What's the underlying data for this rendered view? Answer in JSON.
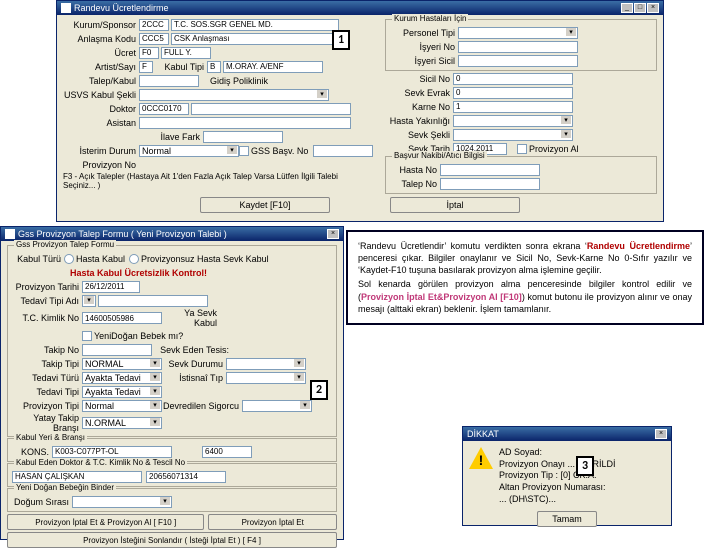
{
  "win1": {
    "title": "Randevu Ücretlendirme",
    "kurumSponsorL": "Kurum/Sponsor",
    "kurumSponsorCode": "2CCC",
    "kurumSponsorText": "T.C. SOS.SGR GENEL MD.",
    "anlasmaKoduL": "Anlaşma Kodu",
    "anlasmaKoduCode": "CCC5",
    "anlasmaKoduText": "CSK Anlaşması",
    "ucretL": "Ücret",
    "ucretCode": "F0",
    "ucretText": "FULL Y.",
    "artistSayiL": "Artist/Sayı",
    "artistSayi": "F",
    "kabulTipiL": "Kabul Tipi",
    "kabulTipiCode": "B",
    "kabulTipiText": "M.ORAY. A/ENF",
    "talepKabulL": "Talep/Kabul",
    "usvsKabulL": "USVS Kabul Şekli",
    "usvsKabul": "",
    "doktorL": "Doktor",
    "doktor": "0CCC0170",
    "asistanL": "Asistan",
    "ilaveFarkL": "İlave Fark",
    "isterimDurumL": "İsterim Durum",
    "isterimDurum": "Normal",
    "provNoL": "Provizyon No",
    "f3L": "F3 - Açık Talepler (Hastaya Ait 1'den Fazla Açık Talep Varsa Lütfen İlgili Talebi Seçiniz... )",
    "gssBasvNoL": "GSS Başv. No",
    "gidisPolL": "Gidiş Poliklinik",
    "kaydetBtn": "Kaydet [F10]",
    "iptalBtn": "İptal",
    "grpKurum": "Kurum Hastaları İçin",
    "personelTipiL": "Personel Tipi",
    "isyeriNoL": "İşyeri No",
    "isyeriSicilL": "İşyeri Sicil",
    "sicilNoL": "Sicil No",
    "sicilNo": "0",
    "sevkEvrakL": "Sevk Evrak",
    "sevkEvrak": "0",
    "karneNoL": "Karne No",
    "karneNo": "1",
    "hastaYakinL": "Hasta Yakınlığı",
    "sevkSekliL": "Sevk Şekli",
    "sevkTarihL": "Sevk Tarih",
    "sevkTarih": "1024.2011",
    "provizyonAlL": "Provizyon Al",
    "grpHasta": "Başvur Nakibi/Atıcı Bilgisi",
    "hastaNoL": "Hasta No",
    "talepNoL": "Talep No"
  },
  "win2": {
    "title": "Gss Provizyon Talep Formu ( Yeni Provizyon Talebi )",
    "grpTop": "Gss Provizyon Talep Formu",
    "kabulTuruL": "Kabul Türü",
    "opt1": "Hasta Kabul",
    "opt2": "Provizyonsuz Hasta Sevk Kabul",
    "warn": "Hasta Kabul Ücretsizlik Kontrol!",
    "provTarihiL": "Provizyon Tarihi",
    "provTarihi": "26/12/2011",
    "tedaviTipiL": "Tedavî Tipi Adı",
    "tedaviTipiCode": "•",
    "tcKimlikL": "T.C. Kimlik No",
    "tcKimlik": "14600505986",
    "yaSevkKabulL": "Ya Sevk Kabul",
    "yeniDoganCB": "YeniDoğan Bebek mı?",
    "takipNoL": "Takip No",
    "sevkEdenTesisL": "Sevk Eden Tesis:",
    "takipTipiL": "Takip Tipi",
    "takipTipi": "NORMAL",
    "sevkDurumuL": "Sevk Durumu",
    "tedaviTuruL": "Tedavi Türü",
    "tedaviTuru": "Ayakta Tedavi",
    "istisnallL": "İstisnaî Tıp",
    "tedaviTipi2L": "Tedavi Tipi",
    "tedaviTipi2": "Ayakta Tedavi",
    "provTipiL": "Provizyon Tipi",
    "provTipi": "Normal",
    "devrSigortaL": "Devredilen Sigorcu",
    "takipBransL": "Yatay Takip Branşı",
    "takipBrans": "N.ORMAL",
    "grpKabul": "Kabul Yeri & Branşı",
    "konsL": "KONS.",
    "konsCode": "K003-C077PT-OL",
    "konsVal": "6400",
    "grpDoktor": "Kabul Eden Doktor & T.C. Kimlik No & Tescil No",
    "doktorAd": "HASAN ÇALIŞKAN",
    "doktorNo": "20656071314",
    "grpYeni": "Yeni Doğan Bebeğin Binder",
    "dogumSirasiL": "Doğum Sırası",
    "btnProvAl": "Provizyon İptal Et & Provizyon Al [ F10 ]",
    "btnProvIptal": "Provizyon İptal Et",
    "btnSonlandir": "Provizyon İsteğini Sonlandır ( İsteği İptal Et ) [ F4 ]"
  },
  "msg": {
    "title": "DİKKAT",
    "l1": "AD Soyad:",
    "l2": "Provizyon Onayı ...   -VERİLDİ",
    "l3": "Provizyon Tip   : [0] CK.A.",
    "l4": "Altan Provizyon Numarası:",
    "l5": "... (DH\\STC)...",
    "btn": "Tamam"
  },
  "explain": {
    "p1a": "‘Randevu Ücretlendir’ komutu verdikten sonra ekrana ‘",
    "p1red": "Randevu Ücretlendirme",
    "p1b": "’ penceresi çıkar. Bilgiler onaylanır ve Sicil No, Sevk-Karne No 0-Sıfır yazılır ve ‘Kaydet-F10 tuşuna basılarak provizyon alma işlemine geçilir.",
    "p2a": "Sol kenarda görülen provizyon alma penceresinde bilgiler kontrol edilir ve (",
    "p2pink": "Provizyon İptal Et&Provizyon Al [F10]",
    "p2b": ") komut butonu ile provizyon alınır ve onay mesajı (alttaki ekran) beklenir. İşlem tamamlanır."
  }
}
